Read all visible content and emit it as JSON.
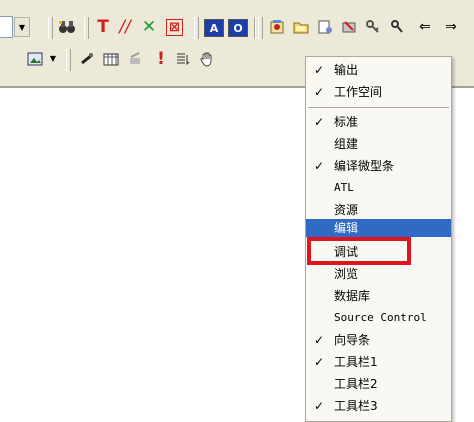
{
  "colors": {
    "toolbar_bg": "#ece9d8",
    "menu_bg": "#f9f8f3",
    "menu_highlight": "#316ac5",
    "annotation": "#e0141e",
    "red_tool": "#d0201c",
    "green_tool": "#1f9a2a",
    "blue_tool": "#1c3ea8"
  },
  "toolbar1": {
    "text_tool_label": "T",
    "line_tool_label": "//",
    "cross_tool_label": "✕",
    "redbox_tool_label": "⊠",
    "a_box_label": "A",
    "o_box_label": "O"
  },
  "toolbar2": {
    "bang_label": "!"
  },
  "menu": {
    "items": [
      {
        "label": "输出",
        "checked": true
      },
      {
        "label": "工作空间",
        "checked": true
      },
      {
        "label": "标准",
        "checked": true
      },
      {
        "label": "组建",
        "checked": false
      },
      {
        "label": "编译微型条",
        "checked": true
      },
      {
        "label": "ATL",
        "checked": false
      },
      {
        "label": "资源",
        "checked": false
      },
      {
        "label": "编辑",
        "checked": false,
        "highlighted": true
      },
      {
        "label": "调试",
        "checked": false
      },
      {
        "label": "浏览",
        "checked": false
      },
      {
        "label": "数据库",
        "checked": false
      },
      {
        "label": "Source Control",
        "checked": false
      },
      {
        "label": "向导条",
        "checked": true
      },
      {
        "label": "工具栏1",
        "checked": true
      },
      {
        "label": "工具栏2",
        "checked": false
      },
      {
        "label": "工具栏3",
        "checked": true
      }
    ],
    "check_mark": "✓"
  }
}
